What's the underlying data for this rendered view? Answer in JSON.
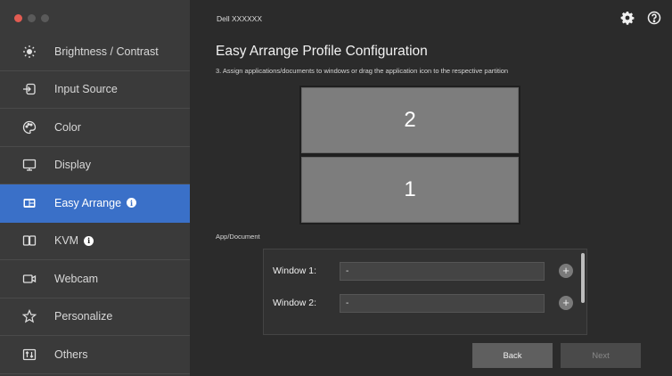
{
  "window": {
    "traffic_lights": [
      "#e25c52",
      "#5a5a5a",
      "#5a5a5a"
    ],
    "monitor_name": "Dell XXXXXX"
  },
  "sidebar": {
    "accent": "#3a70c8",
    "items": [
      {
        "label": "Brightness / Contrast",
        "icon": "brightness-icon",
        "active": false,
        "info": false
      },
      {
        "label": "Input Source",
        "icon": "input-source-icon",
        "active": false,
        "info": false
      },
      {
        "label": "Color",
        "icon": "color-palette-icon",
        "active": false,
        "info": false
      },
      {
        "label": "Display",
        "icon": "display-icon",
        "active": false,
        "info": false
      },
      {
        "label": "Easy Arrange",
        "icon": "easy-arrange-icon",
        "active": true,
        "info": true
      },
      {
        "label": "KVM",
        "icon": "kvm-icon",
        "active": false,
        "info": true
      },
      {
        "label": "Webcam",
        "icon": "webcam-icon",
        "active": false,
        "info": false
      },
      {
        "label": "Personalize",
        "icon": "star-icon",
        "active": false,
        "info": false
      },
      {
        "label": "Others",
        "icon": "others-icon",
        "active": false,
        "info": false
      }
    ]
  },
  "header": {
    "settings_icon": "gear-icon",
    "help_icon": "help-icon"
  },
  "main": {
    "title": "Easy Arrange Profile Configuration",
    "step": "3. Assign applications/documents to windows or drag the application icon to the respective partition",
    "partitions": [
      "2",
      "1"
    ],
    "app_doc_label": "App/Document",
    "windows": [
      {
        "label": "Window 1:",
        "value": "-"
      },
      {
        "label": "Window 2:",
        "value": "-"
      }
    ],
    "back_label": "Back",
    "next_label": "Next"
  }
}
